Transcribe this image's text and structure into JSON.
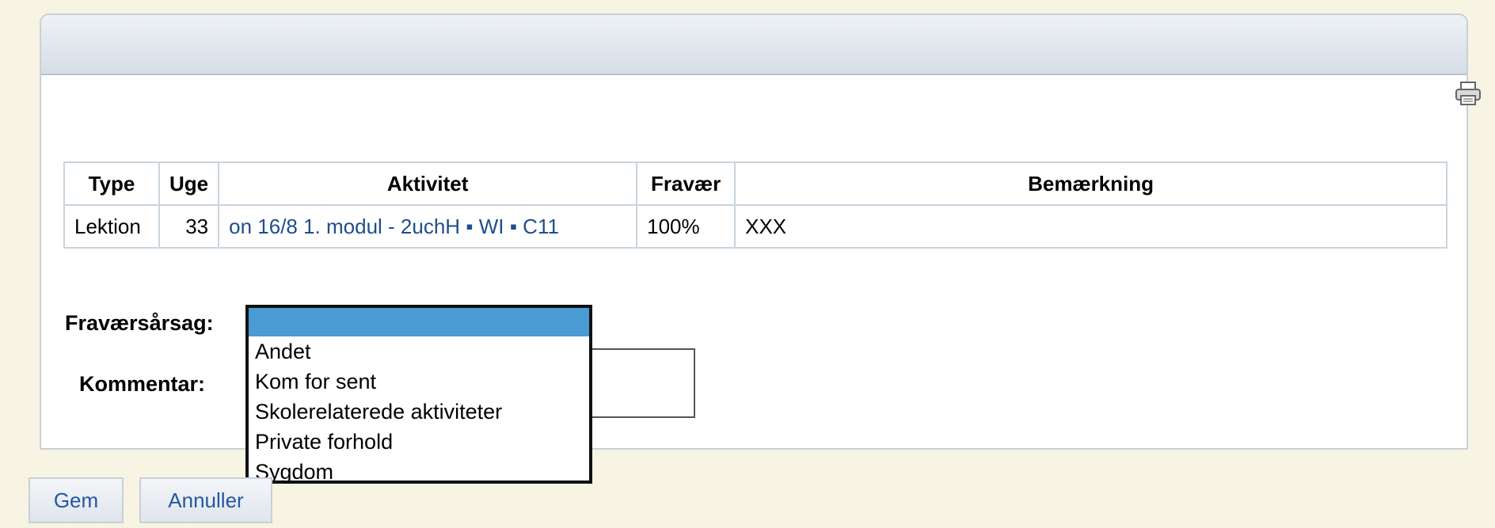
{
  "table": {
    "headers": [
      "Type",
      "Uge",
      "Aktivitet",
      "Fravær",
      "Bemærkning"
    ],
    "rows": [
      [
        "Lektion",
        "33",
        "on 16/8 1. modul - 2uchH ▪ WI ▪ C11",
        "100%",
        "XXX"
      ]
    ]
  },
  "form": {
    "reason_label": "Fraværsårsag:",
    "comment_label": "Kommentar:",
    "comment_value": ""
  },
  "dropdown": {
    "selected": "",
    "options": [
      "",
      "Andet",
      "Kom for sent",
      "Skolerelaterede aktiviteter",
      "Private forhold",
      "Sygdom"
    ]
  },
  "buttons": {
    "save": "Gem",
    "cancel": "Annuller"
  },
  "icons": {
    "print": "print-icon"
  },
  "colors": {
    "background": "#f8f4e3",
    "link": "#1f4e8c",
    "selected_option": "#4a9bd4",
    "button_text": "#2457a0"
  }
}
